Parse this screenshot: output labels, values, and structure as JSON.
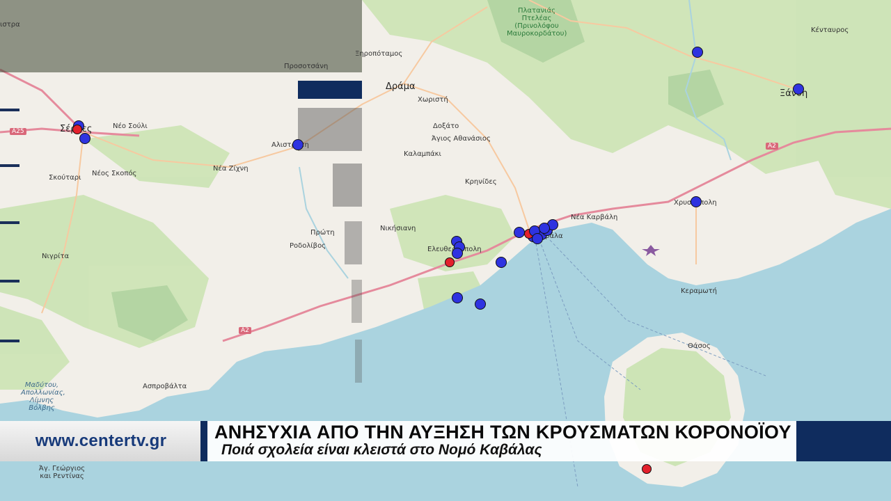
{
  "map": {
    "place_labels": [
      {
        "text": "Δράμα",
        "big": true
      },
      {
        "text": "Χωριστή"
      },
      {
        "text": "Δοξάτο"
      },
      {
        "text": "Άγιος Αθανάσιος"
      },
      {
        "text": "Καλαμπάκι"
      },
      {
        "text": "Κρηνίδες"
      },
      {
        "text": "Προσοτσάνη"
      },
      {
        "text": "Ξηροπόταμος"
      },
      {
        "text": "Νικήσιανη"
      },
      {
        "text": "Ελευθερούπολη"
      },
      {
        "text": "Πρώτη"
      },
      {
        "text": "Ροδολίβος"
      },
      {
        "text": "Νέα Καρβάλη"
      },
      {
        "text": "Καβάλα"
      },
      {
        "text": "Χρυσούπολη"
      },
      {
        "text": "Κεραμωτή"
      },
      {
        "text": "Θάσος"
      },
      {
        "text": "Ξάνθη"
      },
      {
        "text": "Κένταυρος"
      },
      {
        "text": "Νέο Σούλι"
      },
      {
        "text": "Σέρρες"
      },
      {
        "text": "Νέος Σκοπός"
      },
      {
        "text": "Σκούταρι"
      },
      {
        "text": "Νέα Ζίχνη"
      },
      {
        "text": "Αλιστράτη"
      },
      {
        "text": "Νιγρίτα"
      },
      {
        "text": "Ασπροβάλτα"
      },
      {
        "text": "Άγ. Γεώργιος και Ρεντίνας"
      },
      {
        "text": "ιστρα"
      }
    ],
    "green_label": "Πλατανιάς Πτελέας (Πρινολόφου Μαυροκορδάτου)",
    "water_label": "Μαδύτου, Απολλωνίας, Λίμνης Βόλβης",
    "road_shields": [
      "A25",
      "A2",
      "A2"
    ],
    "markers": [
      {
        "color": "blue"
      },
      {
        "color": "blue"
      },
      {
        "color": "red"
      },
      {
        "color": "blue"
      },
      {
        "color": "blue"
      },
      {
        "color": "blue"
      },
      {
        "color": "blue"
      },
      {
        "color": "blue"
      },
      {
        "color": "red"
      },
      {
        "color": "blue"
      },
      {
        "color": "blue"
      },
      {
        "color": "blue"
      },
      {
        "color": "blue"
      },
      {
        "color": "blue"
      },
      {
        "color": "blue"
      },
      {
        "color": "blue"
      },
      {
        "color": "red"
      },
      {
        "color": "blue"
      },
      {
        "color": "blue"
      },
      {
        "color": "blue"
      },
      {
        "color": "blue"
      },
      {
        "color": "blue"
      },
      {
        "color": "red"
      },
      {
        "color": "blue"
      }
    ],
    "colors": {
      "sea": "#aad3df",
      "land": "#f2efe9",
      "forest": "#cde4b6",
      "road": "#e58a9c",
      "marker_blue": "#2f33e0",
      "marker_red": "#e3202c"
    }
  },
  "lower_third": {
    "site": "www.centertv.gr",
    "headline": "ΑΝΗΣΥΧΙΑ ΑΠΟ ΤΗΝ ΑΥΞΗΣΗ ΤΩΝ ΚΡΟΥΣΜΑΤΩΝ ΚΟΡΟΝΟΪΟΥ",
    "subheadline": "Ποιά σχολεία είναι κλειστά στο Νομό Καβάλας",
    "colors": {
      "navy": "#0f2c5e",
      "url": "#173a7a"
    }
  }
}
